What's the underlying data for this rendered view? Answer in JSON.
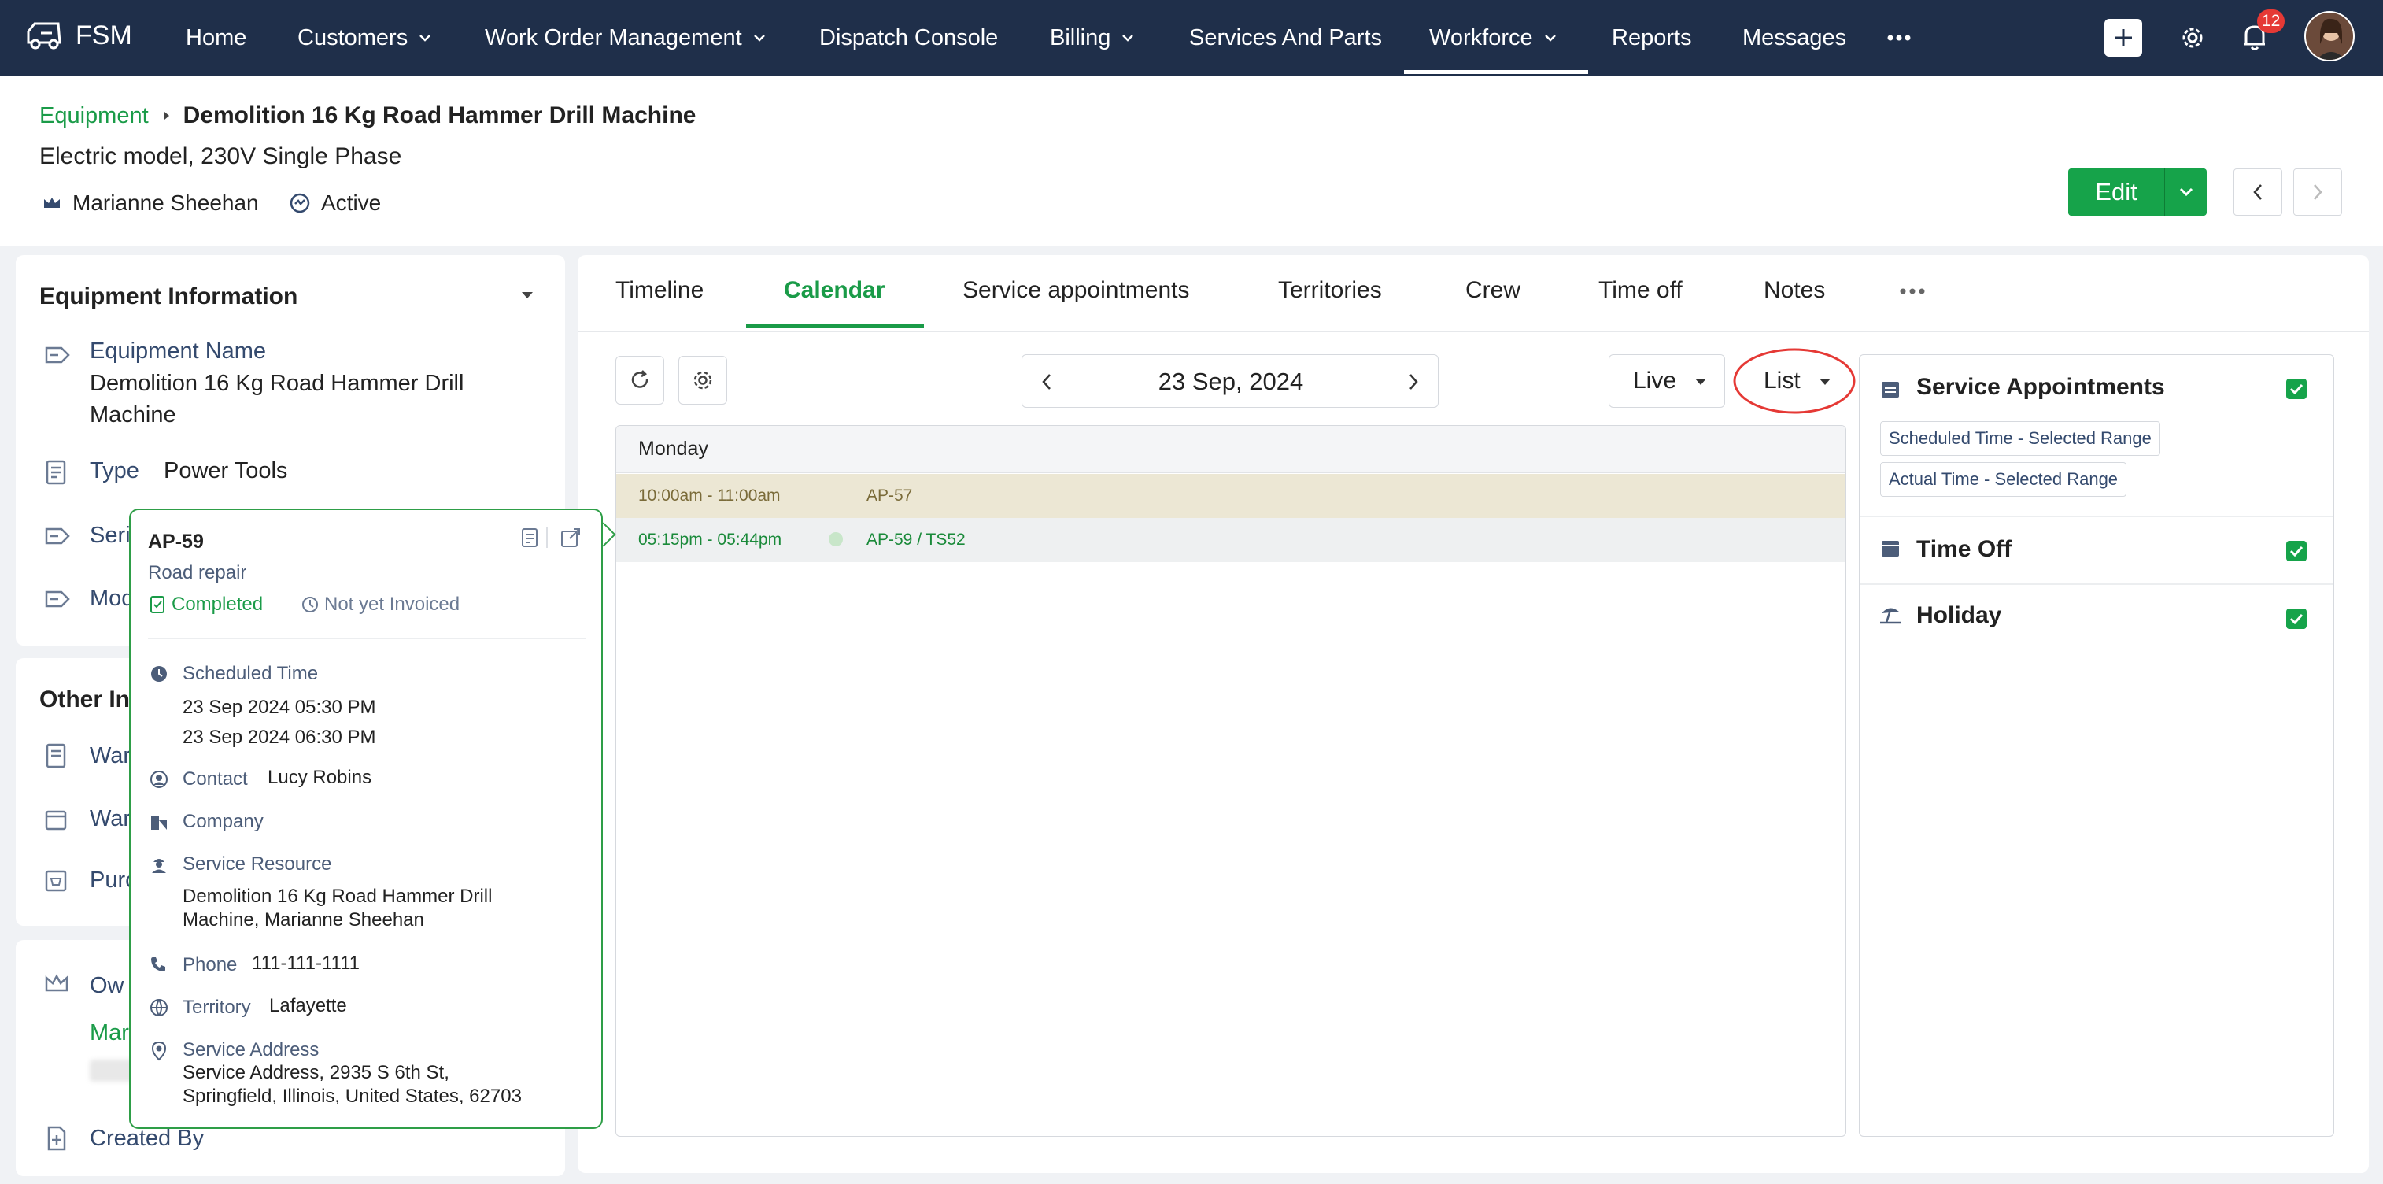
{
  "nav": {
    "app_name": "FSM",
    "items": [
      {
        "label": "Home"
      },
      {
        "label": "Customers"
      },
      {
        "label": "Work Order Management"
      },
      {
        "label": "Dispatch Console"
      },
      {
        "label": "Billing"
      },
      {
        "label": "Services And Parts"
      },
      {
        "label": "Workforce"
      },
      {
        "label": "Reports"
      },
      {
        "label": "Messages"
      }
    ],
    "active": "Workforce",
    "notifications_count": "12"
  },
  "header": {
    "breadcrumb_parent": "Equipment",
    "title": "Demolition 16 Kg Road Hammer Drill Machine",
    "subtitle": "Electric model, 230V Single Phase",
    "owner": "Marianne Sheehan",
    "status": "Active",
    "edit_label": "Edit"
  },
  "left": {
    "equipment_info_title": "Equipment Information",
    "equipment_name_label": "Equipment Name",
    "equipment_name_line1": "Demolition 16 Kg Road Hammer Drill",
    "equipment_name_line2": "Machine",
    "type_label": "Type",
    "type_value": "Power Tools",
    "serial_label_partial": "Seri",
    "model_label_partial": "Mod",
    "other_info_title_partial": "Other Inf",
    "warranty1_partial": "War",
    "warranty2_partial": "War",
    "purchase_partial": "Purc",
    "owner_partial": "Ow",
    "owner_link_partial": "Mar",
    "created_by_label": "Created By"
  },
  "tabs": [
    {
      "label": "Timeline"
    },
    {
      "label": "Calendar"
    },
    {
      "label": "Service appointments"
    },
    {
      "label": "Territories"
    },
    {
      "label": "Crew"
    },
    {
      "label": "Time off"
    },
    {
      "label": "Notes"
    }
  ],
  "calendar": {
    "date": "23 Sep, 2024",
    "mode": "Live",
    "view": "List",
    "day_header": "Monday",
    "events": [
      {
        "time": "10:00am - 11:00am",
        "title": "AP-57"
      },
      {
        "time": "05:15pm - 05:44pm",
        "title": "AP-59 / TS52"
      }
    ]
  },
  "filters": {
    "service_appointments": "Service Appointments",
    "chip1": "Scheduled Time - Selected Range",
    "chip2": "Actual Time - Selected Range",
    "time_off": "Time Off",
    "holiday": "Holiday"
  },
  "popover": {
    "id": "AP-59",
    "name": "Road repair",
    "status": "Completed",
    "invoice_status": "Not yet Invoiced",
    "scheduled_time_label": "Scheduled Time",
    "scheduled_start": "23 Sep 2024 05:30 PM",
    "scheduled_end": "23 Sep 2024 06:30 PM",
    "contact_label": "Contact",
    "contact_value": "Lucy Robins",
    "company_label": "Company",
    "service_resource_label": "Service Resource",
    "service_resource_line1": "Demolition 16 Kg Road Hammer Drill",
    "service_resource_line2": "Machine, Marianne Sheehan",
    "phone_label": "Phone",
    "phone_value": "111-111-1111",
    "territory_label": "Territory",
    "territory_value": "Lafayette",
    "service_address_label": "Service Address",
    "service_address_line1": "Service Address, 2935 S 6th St,",
    "service_address_line2": "Springfield, Illinois, United States, 62703"
  },
  "colors": {
    "nav_bg": "#1f2f4a",
    "accent_green": "#16a34a",
    "annotation_red": "#e53935"
  }
}
